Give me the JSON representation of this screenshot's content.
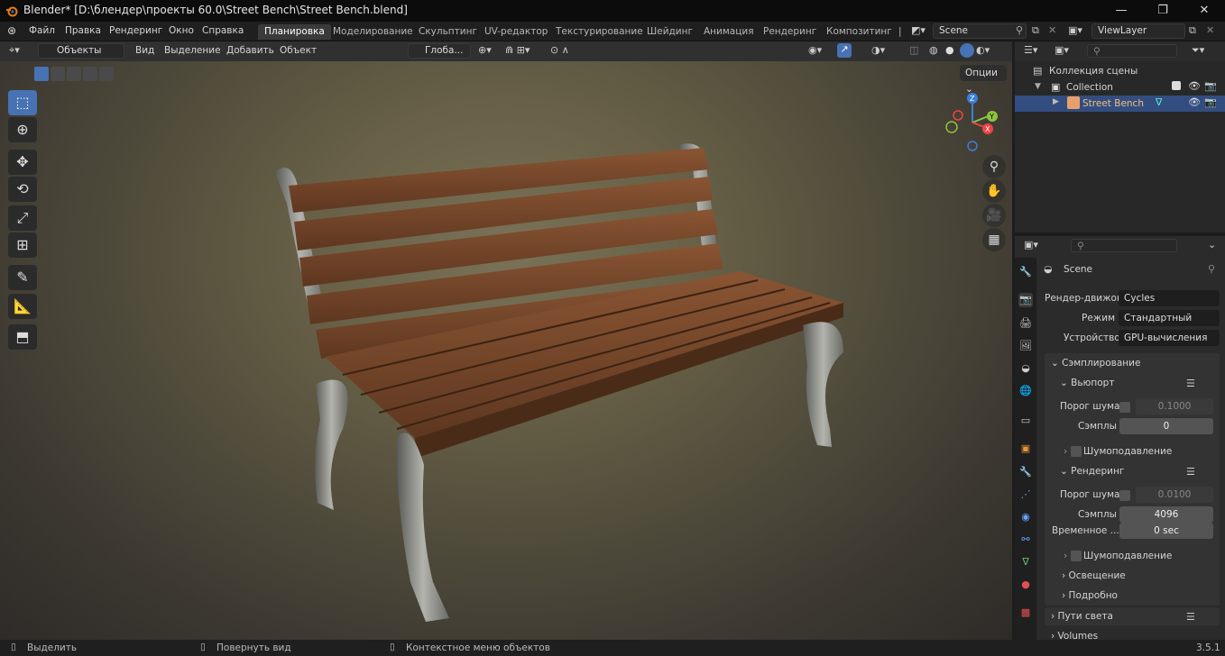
{
  "window": {
    "title": "Blender* [D:\\блендер\\проекты 60.0\\Street Bench\\Street Bench.blend]",
    "minimize": "—",
    "maximize": "❐",
    "close": "✕"
  },
  "menu": [
    "Файл",
    "Правка",
    "Рендеринг",
    "Окно",
    "Справка"
  ],
  "workspaces": [
    "Планировка",
    "Моделирование",
    "Скульптинг",
    "UV-редактор",
    "Текстурирование",
    "Шейдинг",
    "Анимация",
    "Рендеринг",
    "Композитинг",
    "|"
  ],
  "scene": {
    "name": "Scene",
    "view_layer": "ViewLayer"
  },
  "viewport_header": {
    "mode": "Объекты",
    "menus": [
      "Вид",
      "Выделение",
      "Добавить",
      "Объект"
    ],
    "orientation": "Глоба...",
    "options": "Опции"
  },
  "gizmo": {
    "x": "X",
    "y": "Y",
    "z": "Z"
  },
  "outliner": {
    "search_placeholder": "",
    "scene_collection": "Коллекция сцены",
    "collection": "Collection",
    "object": "Street Bench"
  },
  "properties": {
    "scene_label": "Scene",
    "render_engine_label": "Рендер-движок",
    "render_engine": "Cycles",
    "mode_label": "Режим",
    "mode": "Стандартный",
    "device_label": "Устройство",
    "device": "GPU-вычисления",
    "sampling": "Сэмплирование",
    "viewport": "Вьюпорт",
    "vp_noise_threshold_label": "Порог шума",
    "vp_noise_threshold": "0.1000",
    "vp_samples_label": "Сэмплы",
    "vp_samples": "0",
    "vp_denoise": "Шумоподавление",
    "render": "Рендеринг",
    "r_noise_threshold_label": "Порог шума",
    "r_noise_threshold": "0.0100",
    "r_samples_label": "Сэмплы",
    "r_samples": "4096",
    "r_time_label": "Временное ...",
    "r_time": "0 sec",
    "r_denoise": "Шумоподавление",
    "lighting": "Освещение",
    "advanced": "Подробно",
    "light_paths": "Пути света",
    "volumes": "Volumes"
  },
  "status": {
    "select": "Выделить",
    "rotate": "Повернуть вид",
    "context": "Контекстное меню объектов",
    "version": "3.5.1"
  },
  "colors": {
    "accent": "#4772b3",
    "wood": "#7a4a2a",
    "metal": "#8a8a88"
  }
}
